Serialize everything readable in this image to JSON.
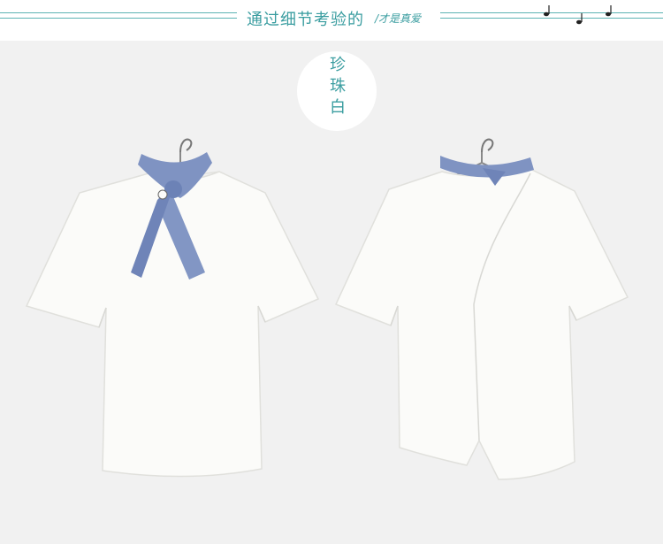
{
  "header": {
    "title": "通过细节考验的",
    "subtitle": "/才是真爱"
  },
  "badge": {
    "color_label": "珍珠白"
  },
  "icons": {
    "decoration": "music-notes-icon"
  },
  "colors": {
    "accent": "#3a9da0",
    "background": "#f1f1f1",
    "shirt": "#fbfbf9",
    "scarf": "#7f93c2"
  }
}
